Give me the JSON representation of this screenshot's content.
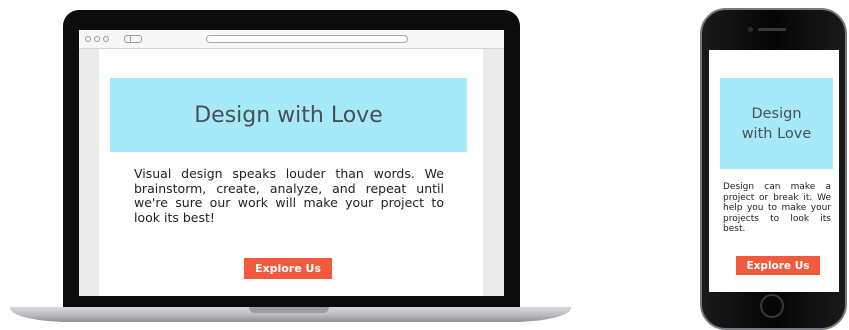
{
  "laptop": {
    "title": "Design with Love",
    "body": "Visual design speaks louder than words. We brainstorm, create, analyze, and repeat until we're sure our work will make your project to look its best!",
    "cta_label": "Explore Us"
  },
  "phone": {
    "title": "Design with Love",
    "body": "Design can make a project or break it. We help you to make your projects to look its best.",
    "cta_label": "Explore Us"
  },
  "colors": {
    "hero_background": "#a6eaf9",
    "cta_background": "#f25a3e",
    "title_text": "#4a4f55"
  },
  "icons": {
    "browser_dots": "window-controls-icon",
    "browser_tab": "tab-icon",
    "phone_home": "home-button-icon"
  }
}
